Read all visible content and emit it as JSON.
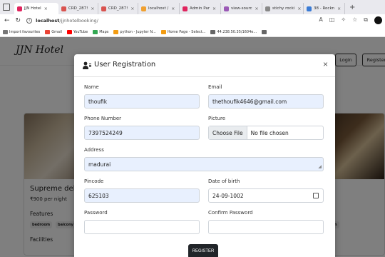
{
  "browser": {
    "tabs": [
      {
        "title": "JJN Hotel",
        "color": "#e0245e"
      },
      {
        "title": "CRD_287!",
        "color": "#d9534f"
      },
      {
        "title": "CRD_287!",
        "color": "#d9534f"
      },
      {
        "title": "localhost /",
        "color": "#f0a030"
      },
      {
        "title": "Admin Par",
        "color": "#e0245e"
      },
      {
        "title": "view-sourc",
        "color": "#9b59b6"
      },
      {
        "title": "stichy rocki",
        "color": "#888888"
      },
      {
        "title": "38 - Rockn",
        "color": "#3a7bd5"
      }
    ],
    "new_tab": "+",
    "url_host": "localhost",
    "url_path": "/jjnhotelbooking/",
    "bookmarks": [
      {
        "label": "Import favourites",
        "color": "#777777"
      },
      {
        "label": "Gmail",
        "color": "#ea4335"
      },
      {
        "label": "YouTube",
        "color": "#ff0000"
      },
      {
        "label": "Maps",
        "color": "#34a853"
      },
      {
        "label": "python - Jupyter N...",
        "color": "#f39c12"
      },
      {
        "label": "Home Page - Select...",
        "color": "#f39c12"
      },
      {
        "label": "44.238.50.35/1604e...",
        "color": "#666666"
      }
    ]
  },
  "site": {
    "brand": "JJN Hotel",
    "login": "Login",
    "register": "Register"
  },
  "room": {
    "name": "Supreme delu",
    "price": "₹900 per night",
    "features_label": "Features",
    "chips": [
      "bedroom",
      "balcony"
    ],
    "facilities_label": "Facilities",
    "right_chip": "hen"
  },
  "modal": {
    "title": "User Registration",
    "close": "×",
    "fields": {
      "name": {
        "label": "Name",
        "value": "thoufik"
      },
      "email": {
        "label": "Email",
        "value": "thethoufik4646@gmail.com"
      },
      "phone": {
        "label": "Phone Number",
        "value": "7397524249"
      },
      "picture": {
        "label": "Picture",
        "button": "Choose File",
        "status": "No file chosen"
      },
      "address": {
        "label": "Address",
        "value": "madurai"
      },
      "pincode": {
        "label": "Pincode",
        "value": "625103"
      },
      "dob": {
        "label": "Date of birth",
        "value": "24-09-1002"
      },
      "password": {
        "label": "Password",
        "value": ""
      },
      "confirm": {
        "label": "Confirm Password",
        "value": ""
      }
    },
    "submit": "REGISTER"
  },
  "colors": {
    "accent": "#212529",
    "autofill": "#e8f0fe"
  }
}
